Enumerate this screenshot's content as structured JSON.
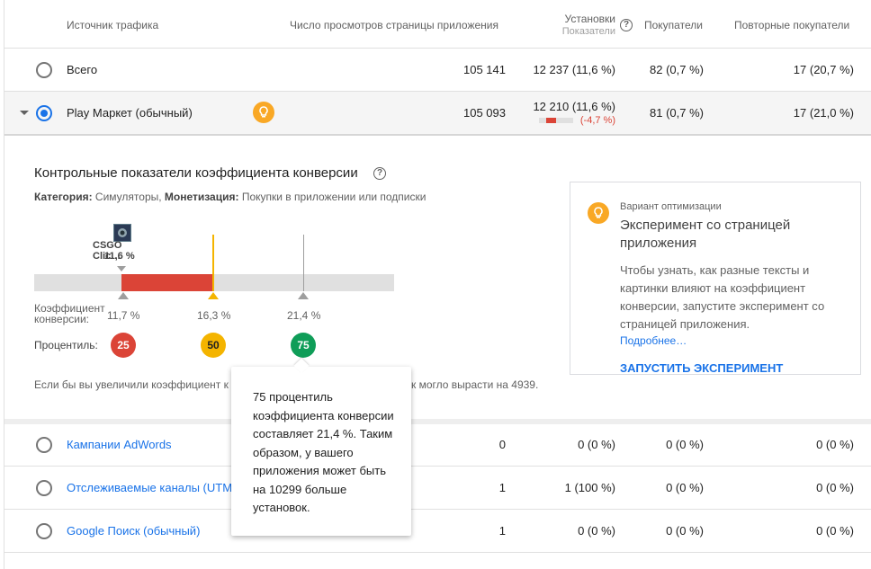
{
  "header": {
    "source": "Источник трафика",
    "views": "Число просмотров страницы приложения",
    "installs": "Установки",
    "installs_sub": "Показатели",
    "buyers": "Покупатели",
    "repeat_buyers": "Повторные покупатели"
  },
  "rows": [
    {
      "name": "Всего",
      "views": "105 141",
      "installs": "12 237 (11,6 %)",
      "buyers": "82 (0,7 %)",
      "repeat": "17 (20,7 %)"
    },
    {
      "name": "Play Маркет (обычный)",
      "views": "105 093",
      "installs": "12 210 (11,6 %)",
      "delta": "(-4,7 %)",
      "buyers": "81 (0,7 %)",
      "repeat": "17 (21,0 %)"
    },
    {
      "name": "Кампании AdWords",
      "views": "0",
      "installs": "0 (0 %)",
      "buyers": "0 (0 %)",
      "repeat": "0 (0 %)"
    },
    {
      "name": "Отслеживаемые каналы (UTM",
      "views": "1",
      "installs": "1 (100 %)",
      "buyers": "0 (0 %)",
      "repeat": "0 (0 %)"
    },
    {
      "name": "Google Поиск (обычный)",
      "views": "1",
      "installs": "0 (0 %)",
      "buyers": "0 (0 %)",
      "repeat": "0 (0 %)"
    }
  ],
  "benchmark": {
    "title": "Контрольные показатели коэффициента конверсии",
    "category_label": "Категория:",
    "category_value": " Симуляторы, ",
    "monetization_label": "Монетизация:",
    "monetization_value": " Покупки в приложении или подписки",
    "app_name": "CSGO Clic…",
    "app_rate": "11,6 %",
    "rate_label_1": "Коэффициент",
    "rate_label_2": "конверсии:",
    "rates": [
      "11,7 %",
      "16,3 %",
      "21,4 %"
    ],
    "percentile_label": "Процентиль:",
    "percentiles": [
      "25",
      "50",
      "75"
    ],
    "footer_left": "Если бы вы увеличили коэффициент к",
    "footer_right": "к могло вырасти на 4939."
  },
  "card": {
    "eyebrow": "Вариант оптимизации",
    "title": "Эксперимент со страницей приложения",
    "body": "Чтобы узнать, как разные тексты и картинки влияют на коэффициент конверсии, запустите эксперимент со страницей приложения.",
    "more": "Подробнее…",
    "action": "ЗАПУСТИТЬ ЭКСПЕРИМЕНТ"
  },
  "tooltip": {
    "text": "75 процентиль коэффициента конверсии составляет 21,4 %. Таким образом, у вашего приложения может быть на 10299 больше установок."
  },
  "colors": {
    "red": "#db4437",
    "yellow": "#f4b400",
    "green": "#0f9d58",
    "blue": "#1a73e8"
  }
}
